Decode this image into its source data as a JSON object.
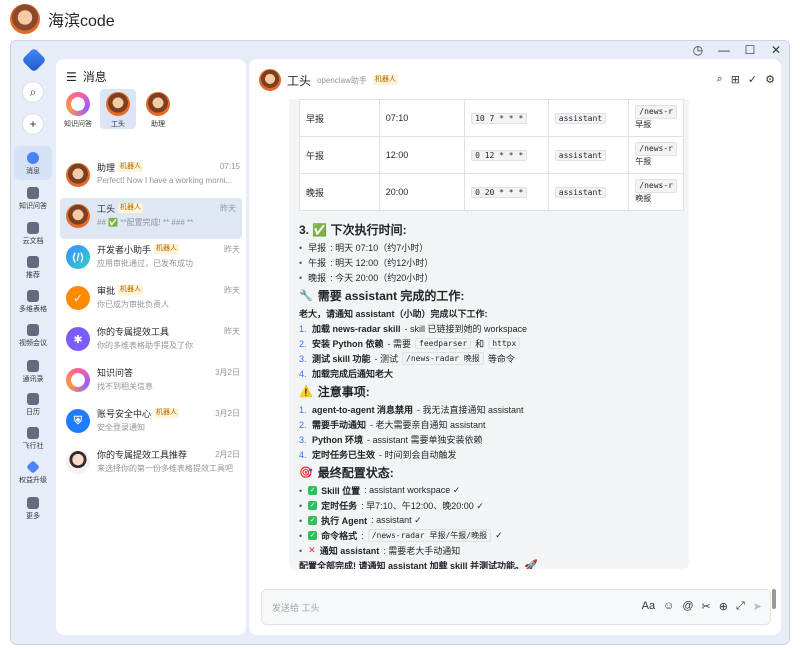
{
  "app": {
    "user_name": "海滨code"
  },
  "rail": {
    "items": [
      {
        "label": "消息"
      },
      {
        "label": "知识问答"
      },
      {
        "label": "云文档"
      },
      {
        "label": "推荐"
      },
      {
        "label": "多维表格"
      },
      {
        "label": "视频会议"
      },
      {
        "label": "通讯录"
      },
      {
        "label": "日历"
      },
      {
        "label": "飞行社"
      },
      {
        "label": "权益升级"
      },
      {
        "label": "更多"
      }
    ]
  },
  "sidebar": {
    "title": "消息",
    "pinned": [
      {
        "label": "知识问答"
      },
      {
        "label": "工头"
      },
      {
        "label": "助理"
      }
    ],
    "chats": [
      {
        "name": "助理",
        "badge": "机器人",
        "time": "07:15",
        "preview": "Perfect! Now I have a working morni..."
      },
      {
        "name": "工头",
        "badge": "机器人",
        "time": "昨天",
        "preview": "## ✅ **配置完成! ** ### **"
      },
      {
        "name": "开发者小助手",
        "badge": "机器人",
        "time": "昨天",
        "preview": "应用审批通过，已发布成功"
      },
      {
        "name": "审批",
        "badge": "机器人",
        "time": "昨天",
        "preview": "你已成为审批负责人"
      },
      {
        "name": "你的专属提效工具",
        "badge": "",
        "time": "昨天",
        "preview": "你的多维表格助手提及了你"
      },
      {
        "name": "知识问答",
        "badge": "",
        "time": "3月2日",
        "preview": "找不到相关信息"
      },
      {
        "name": "账号安全中心",
        "badge": "机器人",
        "time": "3月2日",
        "preview": "安全登录通知"
      },
      {
        "name": "你的专属提效工具推荐",
        "badge": "",
        "time": "2月2日",
        "preview": "来选择你的第一份多维表格提效工具吧"
      }
    ]
  },
  "main": {
    "header": {
      "name": "工头",
      "sub": "openclaw助手",
      "badge": "机器人"
    },
    "table": [
      {
        "name": "早报",
        "time": "07:10",
        "cron": "10 7 * * *",
        "agent": "assistant",
        "cmd": "/news-r",
        "cmd2": "早报"
      },
      {
        "name": "午报",
        "time": "12:00",
        "cron": "0 12 * * *",
        "agent": "assistant",
        "cmd": "/news-r",
        "cmd2": "午报"
      },
      {
        "name": "晚报",
        "time": "20:00",
        "cron": "0 20 * * *",
        "agent": "assistant",
        "cmd": "/news-r",
        "cmd2": "晚报"
      }
    ],
    "sec3_title": "3. ✅ 下次执行时间:",
    "next_runs": [
      {
        "label": "早报",
        "text": ": 明天 07:10（约7小时）"
      },
      {
        "label": "午报",
        "text": ": 明天 12:00（约12小时）"
      },
      {
        "label": "晚报",
        "text": ": 今天 20:00（约20小时）"
      }
    ],
    "sec_needs_title": "需要 assistant 完成的工作:",
    "needs_intro": "老大，请通知 assistant（小助）完成以下工作:",
    "needs": [
      {
        "num": "1.",
        "bold": "加载 news-radar skill",
        "text": " - skill 已链接到她的 workspace"
      },
      {
        "num": "2.",
        "bold": "安装 Python 依赖",
        "text": " - 需要 ",
        "code": "feedparser",
        "text2": " 和 ",
        "code2": "httpx"
      },
      {
        "num": "3.",
        "bold": "测试 skill 功能",
        "text": " - 测试 ",
        "code": "/news-radar 晚报",
        "text2": " 等命令"
      },
      {
        "num": "4.",
        "bold": "加载完成后通知老大",
        "text": ""
      }
    ],
    "sec_notes_title": "注意事项:",
    "notes": [
      {
        "num": "1.",
        "bold": "agent-to-agent 消息禁用",
        "text": " - 我无法直接通知 assistant"
      },
      {
        "num": "2.",
        "bold": "需要手动通知",
        "text": " - 老大需要亲自通知 assistant"
      },
      {
        "num": "3.",
        "bold": "Python 环境",
        "text": " - assistant 需要单独安装依赖"
      },
      {
        "num": "4.",
        "bold": "定时任务已生效",
        "text": " - 时间到会自动触发"
      }
    ],
    "sec_final_title": "最终配置状态:",
    "final": [
      {
        "mark": "✓",
        "bold": "Skill 位置",
        "text": ": assistant workspace ✓"
      },
      {
        "mark": "✓",
        "bold": "定时任务",
        "text": ": 早7:10、午12:00、晚20:00 ✓"
      },
      {
        "mark": "✓",
        "bold": "执行 Agent",
        "text": ": assistant ✓"
      },
      {
        "mark": "✓",
        "bold": "命令格式",
        "text": ": ",
        "code": "/news-radar 早报/午报/晚报",
        "text2": " ✓"
      },
      {
        "mark": "✕",
        "bold": "通知 assistant",
        "text": ": 需要老大手动通知"
      }
    ],
    "closing": "配置全部完成! 请通知 assistant 加载 skill 并测试功能。",
    "input_placeholder": "发送给 工头"
  }
}
